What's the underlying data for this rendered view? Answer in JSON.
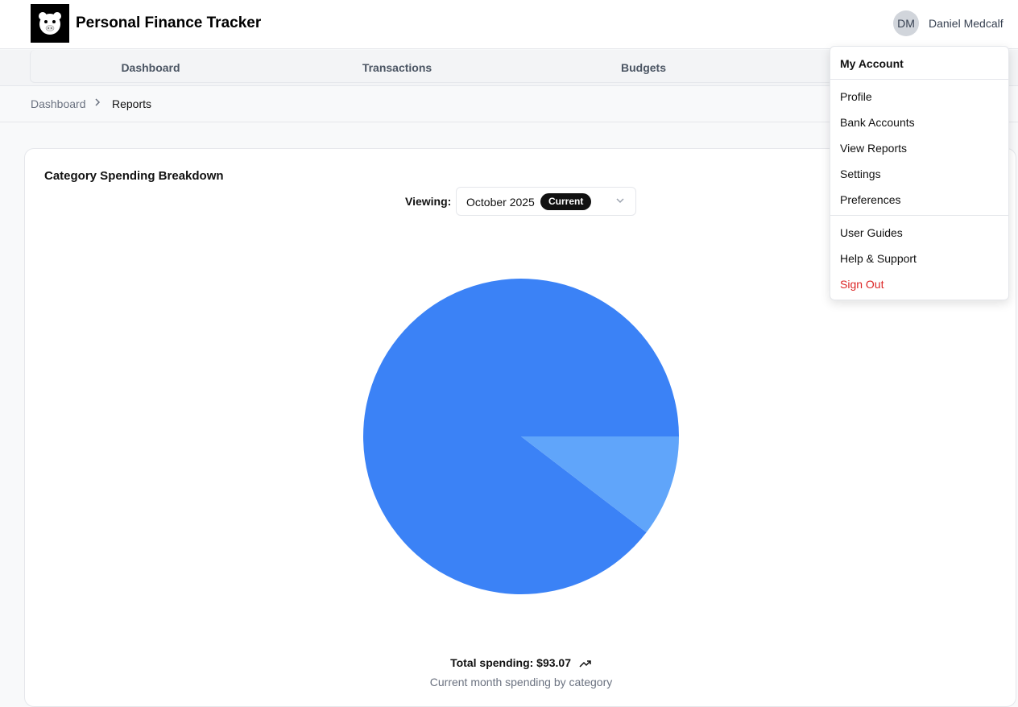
{
  "app": {
    "title": "Personal Finance Tracker"
  },
  "user": {
    "initials": "DM",
    "name": "Daniel Medcalf"
  },
  "nav": {
    "items": [
      "Dashboard",
      "Transactions",
      "Budgets"
    ]
  },
  "breadcrumb": {
    "items": [
      "Dashboard",
      "Reports"
    ]
  },
  "card": {
    "title": "Category Spending Breakdown",
    "viewing_label": "Viewing:",
    "selected_month": "October 2025",
    "badge": "Current",
    "total": "Total spending: $93.07",
    "caption": "Current month spending by category"
  },
  "chart_data": {
    "type": "pie",
    "slices": [
      {
        "value": 89.6,
        "color": "#3b82f6"
      },
      {
        "value": 10.4,
        "color": "#60a5fa"
      }
    ]
  },
  "account_menu": {
    "heading": "My Account",
    "group1": [
      "Profile",
      "Bank Accounts",
      "View Reports",
      "Settings",
      "Preferences"
    ],
    "group2": [
      "User Guides",
      "Help & Support"
    ],
    "sign_out": "Sign Out"
  }
}
